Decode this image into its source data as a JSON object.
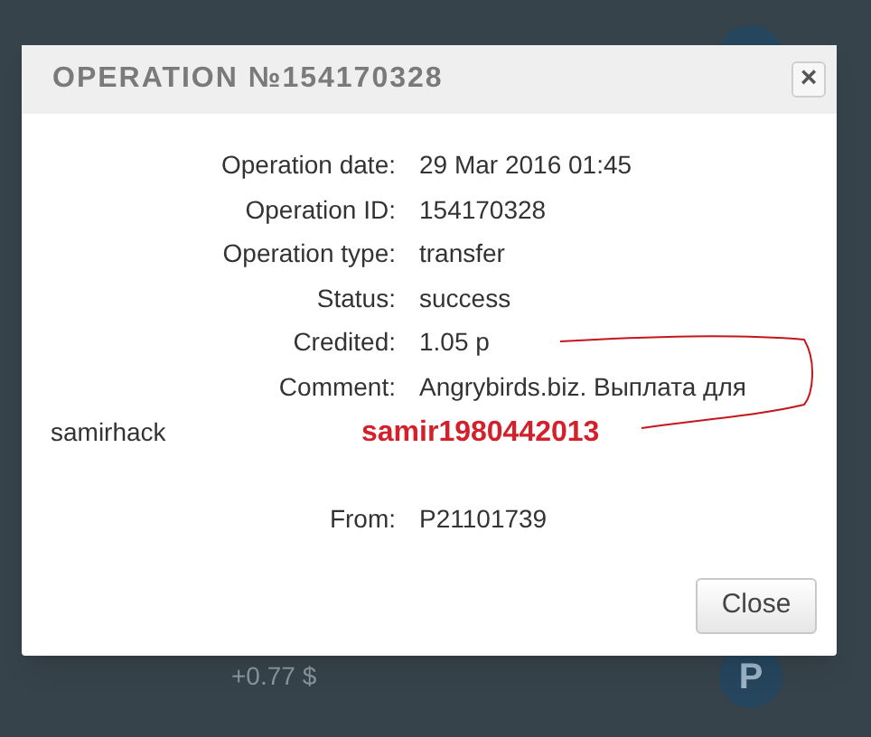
{
  "background": {
    "amount": "+0.77 $",
    "badge": "P"
  },
  "dialog": {
    "title": "OPERATION №154170328",
    "close_icon": "×",
    "fields": [
      {
        "label": "Operation date:",
        "value": "29 Mar 2016 01:45"
      },
      {
        "label": "Operation ID:",
        "value": "154170328"
      },
      {
        "label": "Operation type:",
        "value": "transfer"
      },
      {
        "label": "Status:",
        "value": "success"
      },
      {
        "label": "Credited:",
        "value": "1.05 р"
      },
      {
        "label": "Comment:",
        "value": "Angrybirds.biz. Выплата для"
      }
    ],
    "comment_continuation": "samirhack",
    "annotation": "samir1980442013",
    "from": {
      "label": "From:",
      "value": "P21101739"
    },
    "button": "Close"
  }
}
